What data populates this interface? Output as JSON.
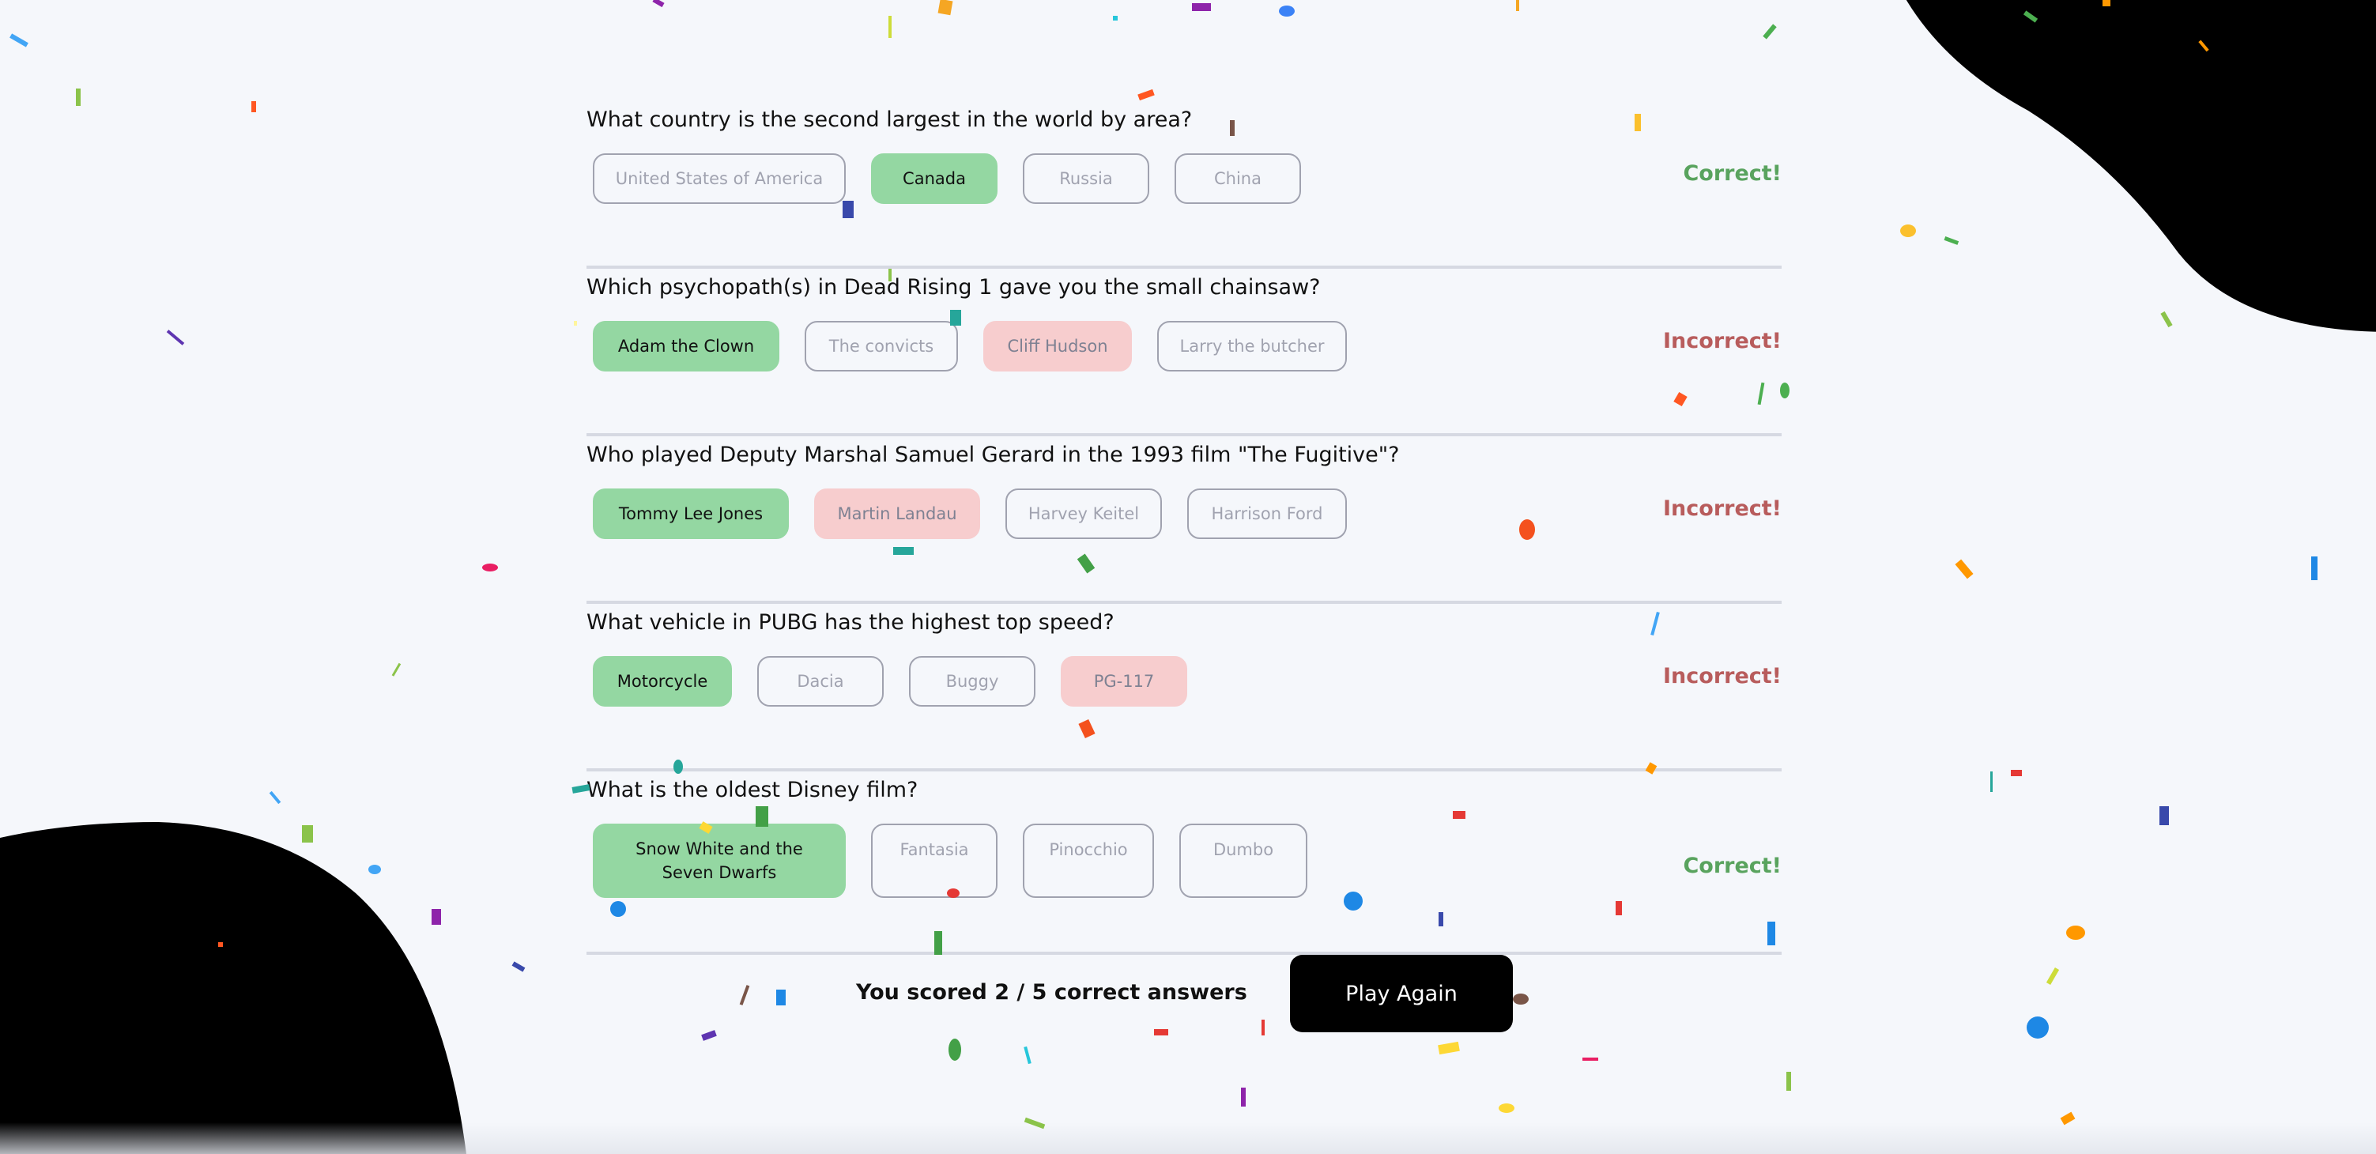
{
  "colors": {
    "background": "#f5f7fb",
    "correct_fill": "#94d7a2",
    "wrong_fill": "#f8bcbc",
    "correct_text": "#59a35e",
    "incorrect_text": "#b85c5c",
    "blob": "#000000"
  },
  "questions": [
    {
      "text": "What country is the second largest in the world by area?",
      "answers": [
        "United States of America",
        "Canada",
        "Russia",
        "China"
      ],
      "result": "Correct!"
    },
    {
      "text": "Which psychopath(s) in Dead Rising 1 gave you the small chainsaw?",
      "answers": [
        "Adam the Clown",
        "The convicts",
        "Cliff Hudson",
        "Larry the butcher"
      ],
      "result": "Incorrect!"
    },
    {
      "text": "Who played Deputy Marshal Samuel Gerard in the 1993 film \"The Fugitive\"?",
      "answers": [
        "Tommy Lee Jones",
        "Martin Landau",
        "Harvey Keitel",
        "Harrison Ford"
      ],
      "result": "Incorrect!"
    },
    {
      "text": "What vehicle in PUBG has the highest top speed?",
      "answers": [
        "Motorcycle",
        "Dacia",
        "Buggy",
        "PG-117"
      ],
      "result": "Incorrect!"
    },
    {
      "text": "What is the oldest Disney film?",
      "answers": [
        "Snow White and the Seven Dwarfs",
        "Fantasia",
        "Pinocchio",
        "Dumbo"
      ],
      "result": "Correct!"
    }
  ],
  "footer": {
    "score_text": "You scored 2 / 5 correct answers",
    "play_again_label": "Play Again"
  }
}
